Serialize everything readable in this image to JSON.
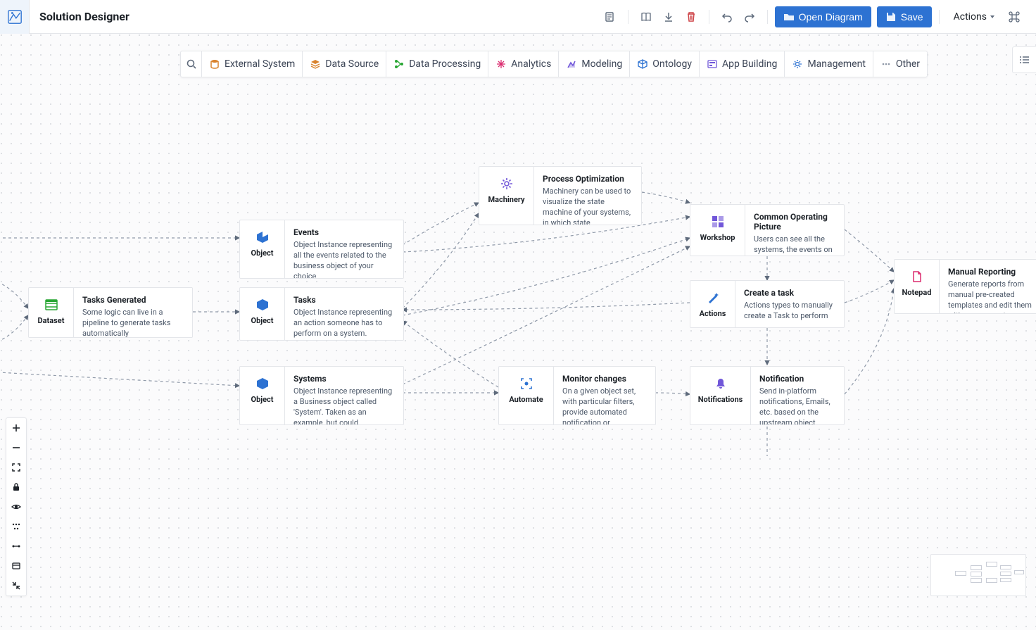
{
  "header": {
    "title": "Solution Designer",
    "open_diagram": "Open Diagram",
    "save": "Save",
    "actions": "Actions"
  },
  "palette": {
    "items": [
      {
        "label": "External System",
        "color": "#d9822b",
        "icon": "db"
      },
      {
        "label": "Data Source",
        "color": "#d9822b",
        "icon": "layers"
      },
      {
        "label": "Data Processing",
        "color": "#29a634",
        "icon": "nodes"
      },
      {
        "label": "Analytics",
        "color": "#db2c6f",
        "icon": "analytics"
      },
      {
        "label": "Modeling",
        "color": "#7157d9",
        "icon": "model"
      },
      {
        "label": "Ontology",
        "color": "#2d72d2",
        "icon": "cube"
      },
      {
        "label": "App Building",
        "color": "#7157d9",
        "icon": "app"
      },
      {
        "label": "Management",
        "color": "#2d72d2",
        "icon": "gear"
      },
      {
        "label": "Other",
        "color": "#8f99a8",
        "icon": "dots"
      }
    ]
  },
  "nodes": {
    "dataset": {
      "type": "Dataset",
      "title": "Tasks Generated",
      "desc": "Some logic can live in a pipeline to generate tasks automatically"
    },
    "events": {
      "type": "Object",
      "title": "Events",
      "desc": "Object Instance representing all the events related to the business object of your choice"
    },
    "tasks": {
      "type": "Object",
      "title": "Tasks",
      "desc": "Object Instance representing an action someone has to perform on a system."
    },
    "systems": {
      "type": "Object",
      "title": "Systems",
      "desc": "Object Instance representing a Business object called 'System'. Taken as an example, but could"
    },
    "machinery": {
      "type": "Machinery",
      "title": "Process Optimization",
      "desc": "Machinery can be used to visualize the state machine of your systems, in which state"
    },
    "automate": {
      "type": "Automate",
      "title": "Monitor changes",
      "desc": "On a given object set, with particular filters, provide automated notification or"
    },
    "workshop": {
      "type": "Workshop",
      "title": "Common Operating Picture",
      "desc": "Users can see all the systems, the events on those systems, and create tasks to perform."
    },
    "actions": {
      "type": "Actions",
      "title": "Create a task",
      "desc": "Actions types to manually create a Task to perform"
    },
    "notifications": {
      "type": "Notifications",
      "title": "Notification",
      "desc": "Send in-platform notifications, Emails, etc. based on the upstream object creation or"
    },
    "notepad": {
      "type": "Notepad",
      "title": "Manual Reporting",
      "desc": "Generate reports from manual pre-created templates and edit them with your current analysis"
    }
  }
}
